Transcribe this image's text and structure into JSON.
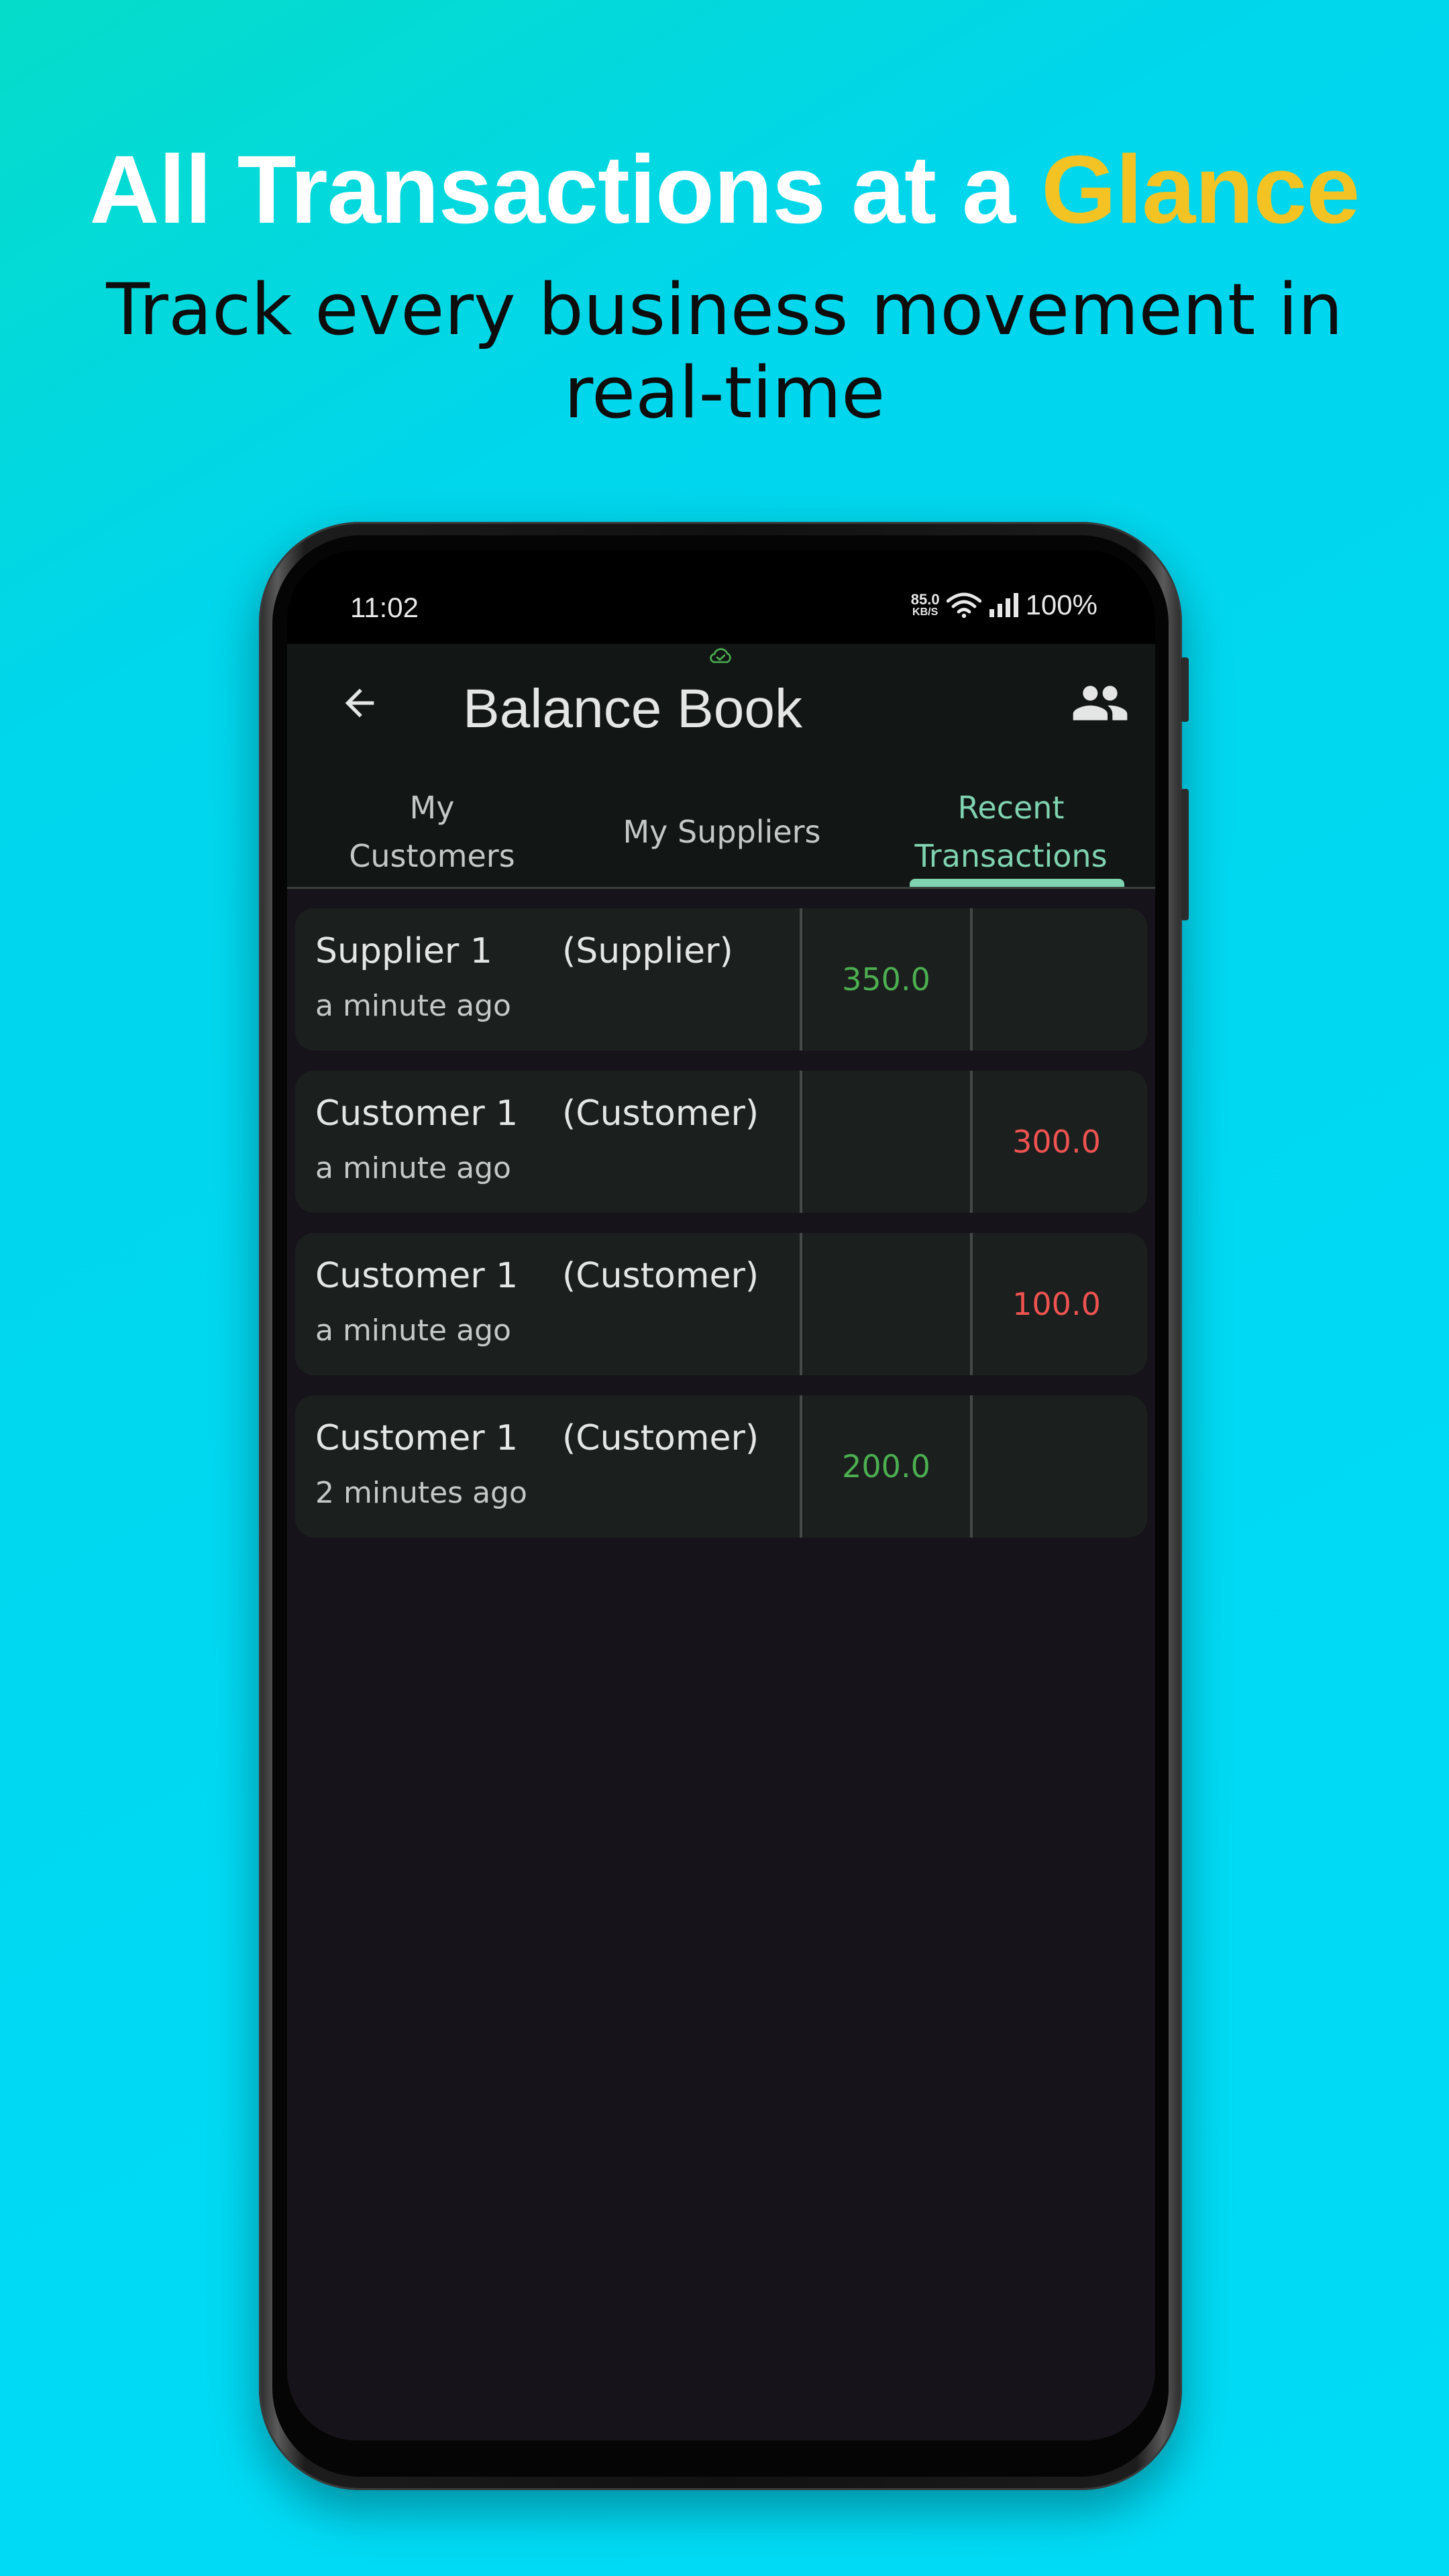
{
  "promo": {
    "headline_main": "All Transactions at a ",
    "headline_accent": "Glance",
    "subtitle": "Track every business movement in real-time"
  },
  "status_bar": {
    "time": "11:02",
    "net_speed": "85.0",
    "net_speed_unit": "KB/S",
    "battery": "100%"
  },
  "app_bar": {
    "title": "Balance Book",
    "back_icon": "arrow-back-icon",
    "right_icon": "group-icon",
    "sync_icon": "cloud-done-icon"
  },
  "tabs": [
    {
      "label": "My\nCustomers",
      "active": false
    },
    {
      "label": "My Suppliers",
      "active": false
    },
    {
      "label": "Recent\nTransactions",
      "active": true
    }
  ],
  "transactions": [
    {
      "name": "Supplier 1",
      "type": "(Supplier)",
      "time": "a minute ago",
      "credit": "350.0",
      "debit": ""
    },
    {
      "name": "Customer 1",
      "type": "(Customer)",
      "time": "a minute ago",
      "credit": "",
      "debit": "300.0"
    },
    {
      "name": "Customer 1",
      "type": "(Customer)",
      "time": "a minute ago",
      "credit": "",
      "debit": "100.0"
    },
    {
      "name": "Customer 1",
      "type": "(Customer)",
      "time": "2 minutes ago",
      "credit": "200.0",
      "debit": ""
    }
  ],
  "colors": {
    "accent": "#f3c324",
    "credit": "#4caf50",
    "debit": "#ef5350",
    "active_tab": "#7fd3b0"
  }
}
